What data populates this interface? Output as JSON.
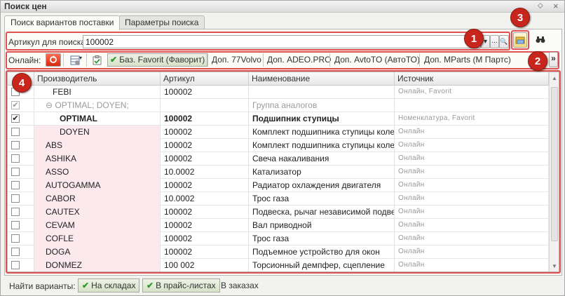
{
  "window": {
    "title": "Поиск цен",
    "controls": [
      "⬦",
      "×"
    ]
  },
  "tabs": [
    {
      "label": "Поиск вариантов поставки",
      "active": true
    },
    {
      "label": "Параметры поиска",
      "active": false
    }
  ],
  "search": {
    "label": "Артикул для поиска:",
    "value": "100002",
    "dropdown_glyph": "▾",
    "more_glyph": "...",
    "search_glyph": "🔍"
  },
  "callouts": [
    "1",
    "2",
    "3",
    "4"
  ],
  "online": {
    "label": "Онлайн:",
    "buttons": [
      {
        "label": "Баз. Favorit (Фаворит)",
        "checked": true
      },
      {
        "label": "Доп. 77Volvo",
        "checked": false
      },
      {
        "label": "Доп. ADEO.PRO",
        "checked": false
      },
      {
        "label": "Доп. AvtoTO (АвтоТО)",
        "checked": false
      },
      {
        "label": "Доп. MParts (М Партс)",
        "checked": false
      }
    ],
    "more_glyph": "»"
  },
  "grid": {
    "headers": [
      "Производитель",
      "Артикул",
      "Наименование",
      "Источник"
    ],
    "rows": [
      {
        "checked": "",
        "maker": "FEBI",
        "indent": 2,
        "article": "100002",
        "name": "",
        "source": "Онлайн, Favorit",
        "style": "normal",
        "pink": false
      },
      {
        "checked": "✔",
        "maker": "⊖ OPTIMAL; DOYEN;",
        "indent": 1,
        "article": "",
        "name": "Группа аналогов",
        "source": "",
        "style": "group",
        "pink": false
      },
      {
        "checked": "✔",
        "maker": "OPTIMAL",
        "indent": 3,
        "article": "100002",
        "name": "Подшипник ступицы",
        "source": "Номенклатура, Favorit",
        "style": "bold",
        "pink": false
      },
      {
        "checked": "",
        "maker": "DOYEN",
        "indent": 3,
        "article": "100002",
        "name": "Комплект подшипника ступицы колеса",
        "source": "Онлайн",
        "style": "normal",
        "pink": true
      },
      {
        "checked": "",
        "maker": "ABS",
        "indent": 1,
        "article": "100002",
        "name": "Комплект подшипника ступицы колеса",
        "source": "Онлайн",
        "style": "normal",
        "pink": true
      },
      {
        "checked": "",
        "maker": "ASHIKA",
        "indent": 1,
        "article": "100002",
        "name": "Свеча накаливания",
        "source": "Онлайн",
        "style": "normal",
        "pink": true
      },
      {
        "checked": "",
        "maker": "ASSO",
        "indent": 1,
        "article": "10.0002",
        "name": "Катализатор",
        "source": "Онлайн",
        "style": "normal",
        "pink": true
      },
      {
        "checked": "",
        "maker": "AUTOGAMMA",
        "indent": 1,
        "article": "100002",
        "name": "Радиатор охлаждения двигателя",
        "source": "Онлайн",
        "style": "normal",
        "pink": true
      },
      {
        "checked": "",
        "maker": "CABOR",
        "indent": 1,
        "article": "10.0002",
        "name": "Трос газа",
        "source": "Онлайн",
        "style": "normal",
        "pink": true
      },
      {
        "checked": "",
        "maker": "CAUTEX",
        "indent": 1,
        "article": "100002",
        "name": "Подвеска, рычаг независимой подве...",
        "source": "Онлайн",
        "style": "normal",
        "pink": true
      },
      {
        "checked": "",
        "maker": "CEVAM",
        "indent": 1,
        "article": "100002",
        "name": "Вал приводной",
        "source": "Онлайн",
        "style": "normal",
        "pink": true
      },
      {
        "checked": "",
        "maker": "COFLE",
        "indent": 1,
        "article": "100002",
        "name": "Трос газа",
        "source": "Онлайн",
        "style": "normal",
        "pink": true
      },
      {
        "checked": "",
        "maker": "DOGA",
        "indent": 1,
        "article": "100002",
        "name": "Подъемное устройство для окон",
        "source": "Онлайн",
        "style": "normal",
        "pink": true
      },
      {
        "checked": "",
        "maker": "DONMEZ",
        "indent": 1,
        "article": "100 002",
        "name": "Торсионный демпфер, сцепление",
        "source": "Онлайн",
        "style": "normal",
        "pink": true
      }
    ]
  },
  "footer": {
    "label": "Найти варианты:",
    "buttons": [
      {
        "label": "На складах",
        "checked": true
      },
      {
        "label": "В прайс-листах",
        "checked": true
      },
      {
        "label": "В заказах",
        "checked": false
      }
    ]
  },
  "colors": {
    "callout": "#c8261c",
    "highlight": "#e05050",
    "pink_row": "#fbe9ee",
    "check": "#2a9a2a"
  }
}
